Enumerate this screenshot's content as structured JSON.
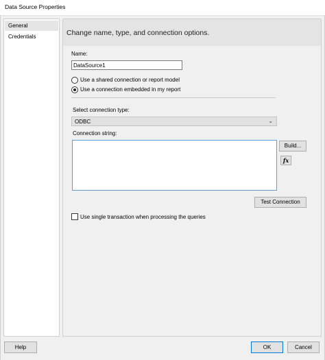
{
  "window": {
    "title": "Data Source Properties"
  },
  "nav": {
    "items": [
      {
        "label": "General",
        "selected": true
      },
      {
        "label": "Credentials",
        "selected": false
      }
    ]
  },
  "header": {
    "text": "Change name, type, and connection options."
  },
  "form": {
    "name_label": "Name:",
    "name_value": "DataSource1",
    "radio_shared": {
      "label": "Use a shared connection or report model",
      "checked": false
    },
    "radio_embedded": {
      "label": "Use a connection embedded in my report",
      "checked": true
    },
    "connection_type_label": "Select connection type:",
    "connection_type_value": "ODBC",
    "connection_string_label": "Connection string:",
    "connection_string_value": "",
    "build_label": "Build...",
    "fx_label": "fx",
    "test_connection_label": "Test Connection",
    "single_transaction": {
      "label": "Use single transaction when processing the queries",
      "checked": false
    }
  },
  "footer": {
    "help_label": "Help",
    "ok_label": "OK",
    "cancel_label": "Cancel"
  },
  "colors": {
    "accent": "#0078d7",
    "focus_border": "#5ba0d6",
    "header_band": "#e4e4e4",
    "panel_bg": "#f0f0f0"
  }
}
